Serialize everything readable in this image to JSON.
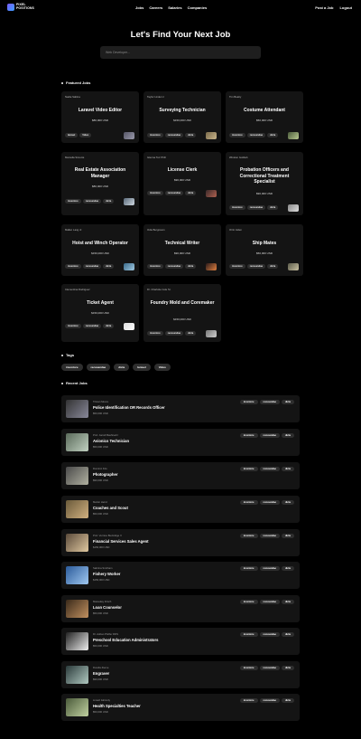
{
  "brand": {
    "line1": "PIXEL",
    "line2": "POSITIONS"
  },
  "nav": {
    "links": [
      "Jobs",
      "Careers",
      "Salaries",
      "Companies"
    ],
    "right": [
      "Post a Job",
      "Logout"
    ]
  },
  "hero": {
    "title": "Let's Find Your Next Job",
    "search_placeholder": "Web Developer..."
  },
  "featured": {
    "heading": "Featured Jobs",
    "cards": [
      {
        "company": "Nadia Sabina",
        "title": "Laravel Video Editor",
        "salary": "$80,000 USD",
        "tags": [
          "laravel",
          "Video"
        ]
      },
      {
        "company": "Taylor Lindem I",
        "title": "Surveying Technician",
        "salary": "$150,000 USD",
        "tags": [
          "inventore",
          "recusandae",
          "dicta"
        ]
      },
      {
        "company": "Tim Beatty",
        "title": "Costume Attendant",
        "salary": "$50,000 USD",
        "tags": [
          "inventore",
          "recusandae",
          "dicta"
        ]
      },
      {
        "company": "Marcella Simonis",
        "title": "Real Estate Association Manager",
        "salary": "$80,000 USD",
        "tags": [
          "inventore",
          "recusandae",
          "dicta"
        ]
      },
      {
        "company": "Glenna Torr PhD",
        "title": "License Clerk",
        "salary": "$90,000 USD",
        "tags": [
          "inventore",
          "recusandae",
          "dicta"
        ]
      },
      {
        "company": "Winston Gottlieb",
        "title": "Probation Officers and Correctional Treatment Specialist",
        "salary": "$90,000 USD",
        "tags": [
          "inventore",
          "recusandae",
          "dicta"
        ]
      },
      {
        "company": "Mallen Lang Jr.",
        "title": "Hoist and Winch Operator",
        "salary": "$150,000 USD",
        "tags": [
          "inventore",
          "recusandae",
          "dicta"
        ]
      },
      {
        "company": "Odie Bergnaum",
        "title": "Technical Writer",
        "salary": "$90,000 USD",
        "tags": [
          "inventore",
          "recusandae",
          "dicta"
        ]
      },
      {
        "company": "Orrin Aiden",
        "title": "Ship Mates",
        "salary": "$50,000 USD",
        "tags": [
          "inventore",
          "recusandae",
          "dicta"
        ]
      },
      {
        "company": "Clementina Rodriguez",
        "title": "Ticket Agent",
        "salary": "$150,000 USD",
        "tags": [
          "inventore",
          "recusandae",
          "dicta"
        ]
      },
      {
        "company": "Dr. Charlotte Cole Sr.",
        "title": "Foundry Mold and Coremaker",
        "salary": "$150,000 USD",
        "tags": [
          "inventore",
          "recusandae",
          "dicta"
        ]
      }
    ]
  },
  "tags": {
    "heading": "Tags",
    "items": [
      "inventore",
      "recusandae",
      "dicta",
      "laravel",
      "Video"
    ]
  },
  "recent": {
    "heading": "Recent Jobs",
    "rows": [
      {
        "company": "Tristan Moore",
        "title": "Police Identification OR Records Officer",
        "salary": "$50,000 USD"
      },
      {
        "company": "Prof. Jarrell Bashiredi I",
        "title": "Avionics Technician",
        "salary": "$50,000 USD"
      },
      {
        "company": "Dominic Kris",
        "title": "Photographer",
        "salary": "$90,000 USD"
      },
      {
        "company": "Melvin Heinz",
        "title": "Coaches and Scout",
        "salary": "$50,000 USD"
      },
      {
        "company": "Prof. Vernice Buckridge II",
        "title": "Financial Services Sales Agent",
        "salary": "$150,000 USD"
      },
      {
        "company": "Sabrina Smitham",
        "title": "Fishery Worker",
        "salary": "$150,000 USD"
      },
      {
        "company": "Macaulay Frisch",
        "title": "Loan Counselor",
        "salary": "$50,000 USD"
      },
      {
        "company": "Dr. Adrian Pfeffer DDS",
        "title": "Preschool Education Administrators",
        "salary": "$50,000 USD"
      },
      {
        "company": "Dorella Zieme",
        "title": "Engraver",
        "salary": "$90,000 USD"
      },
      {
        "company": "Linsell Iskinndy",
        "title": "Health Specialties Teacher",
        "salary": "$50,000 USD"
      }
    ],
    "row_tags": [
      "inventore",
      "recusandae",
      "dicta"
    ]
  }
}
